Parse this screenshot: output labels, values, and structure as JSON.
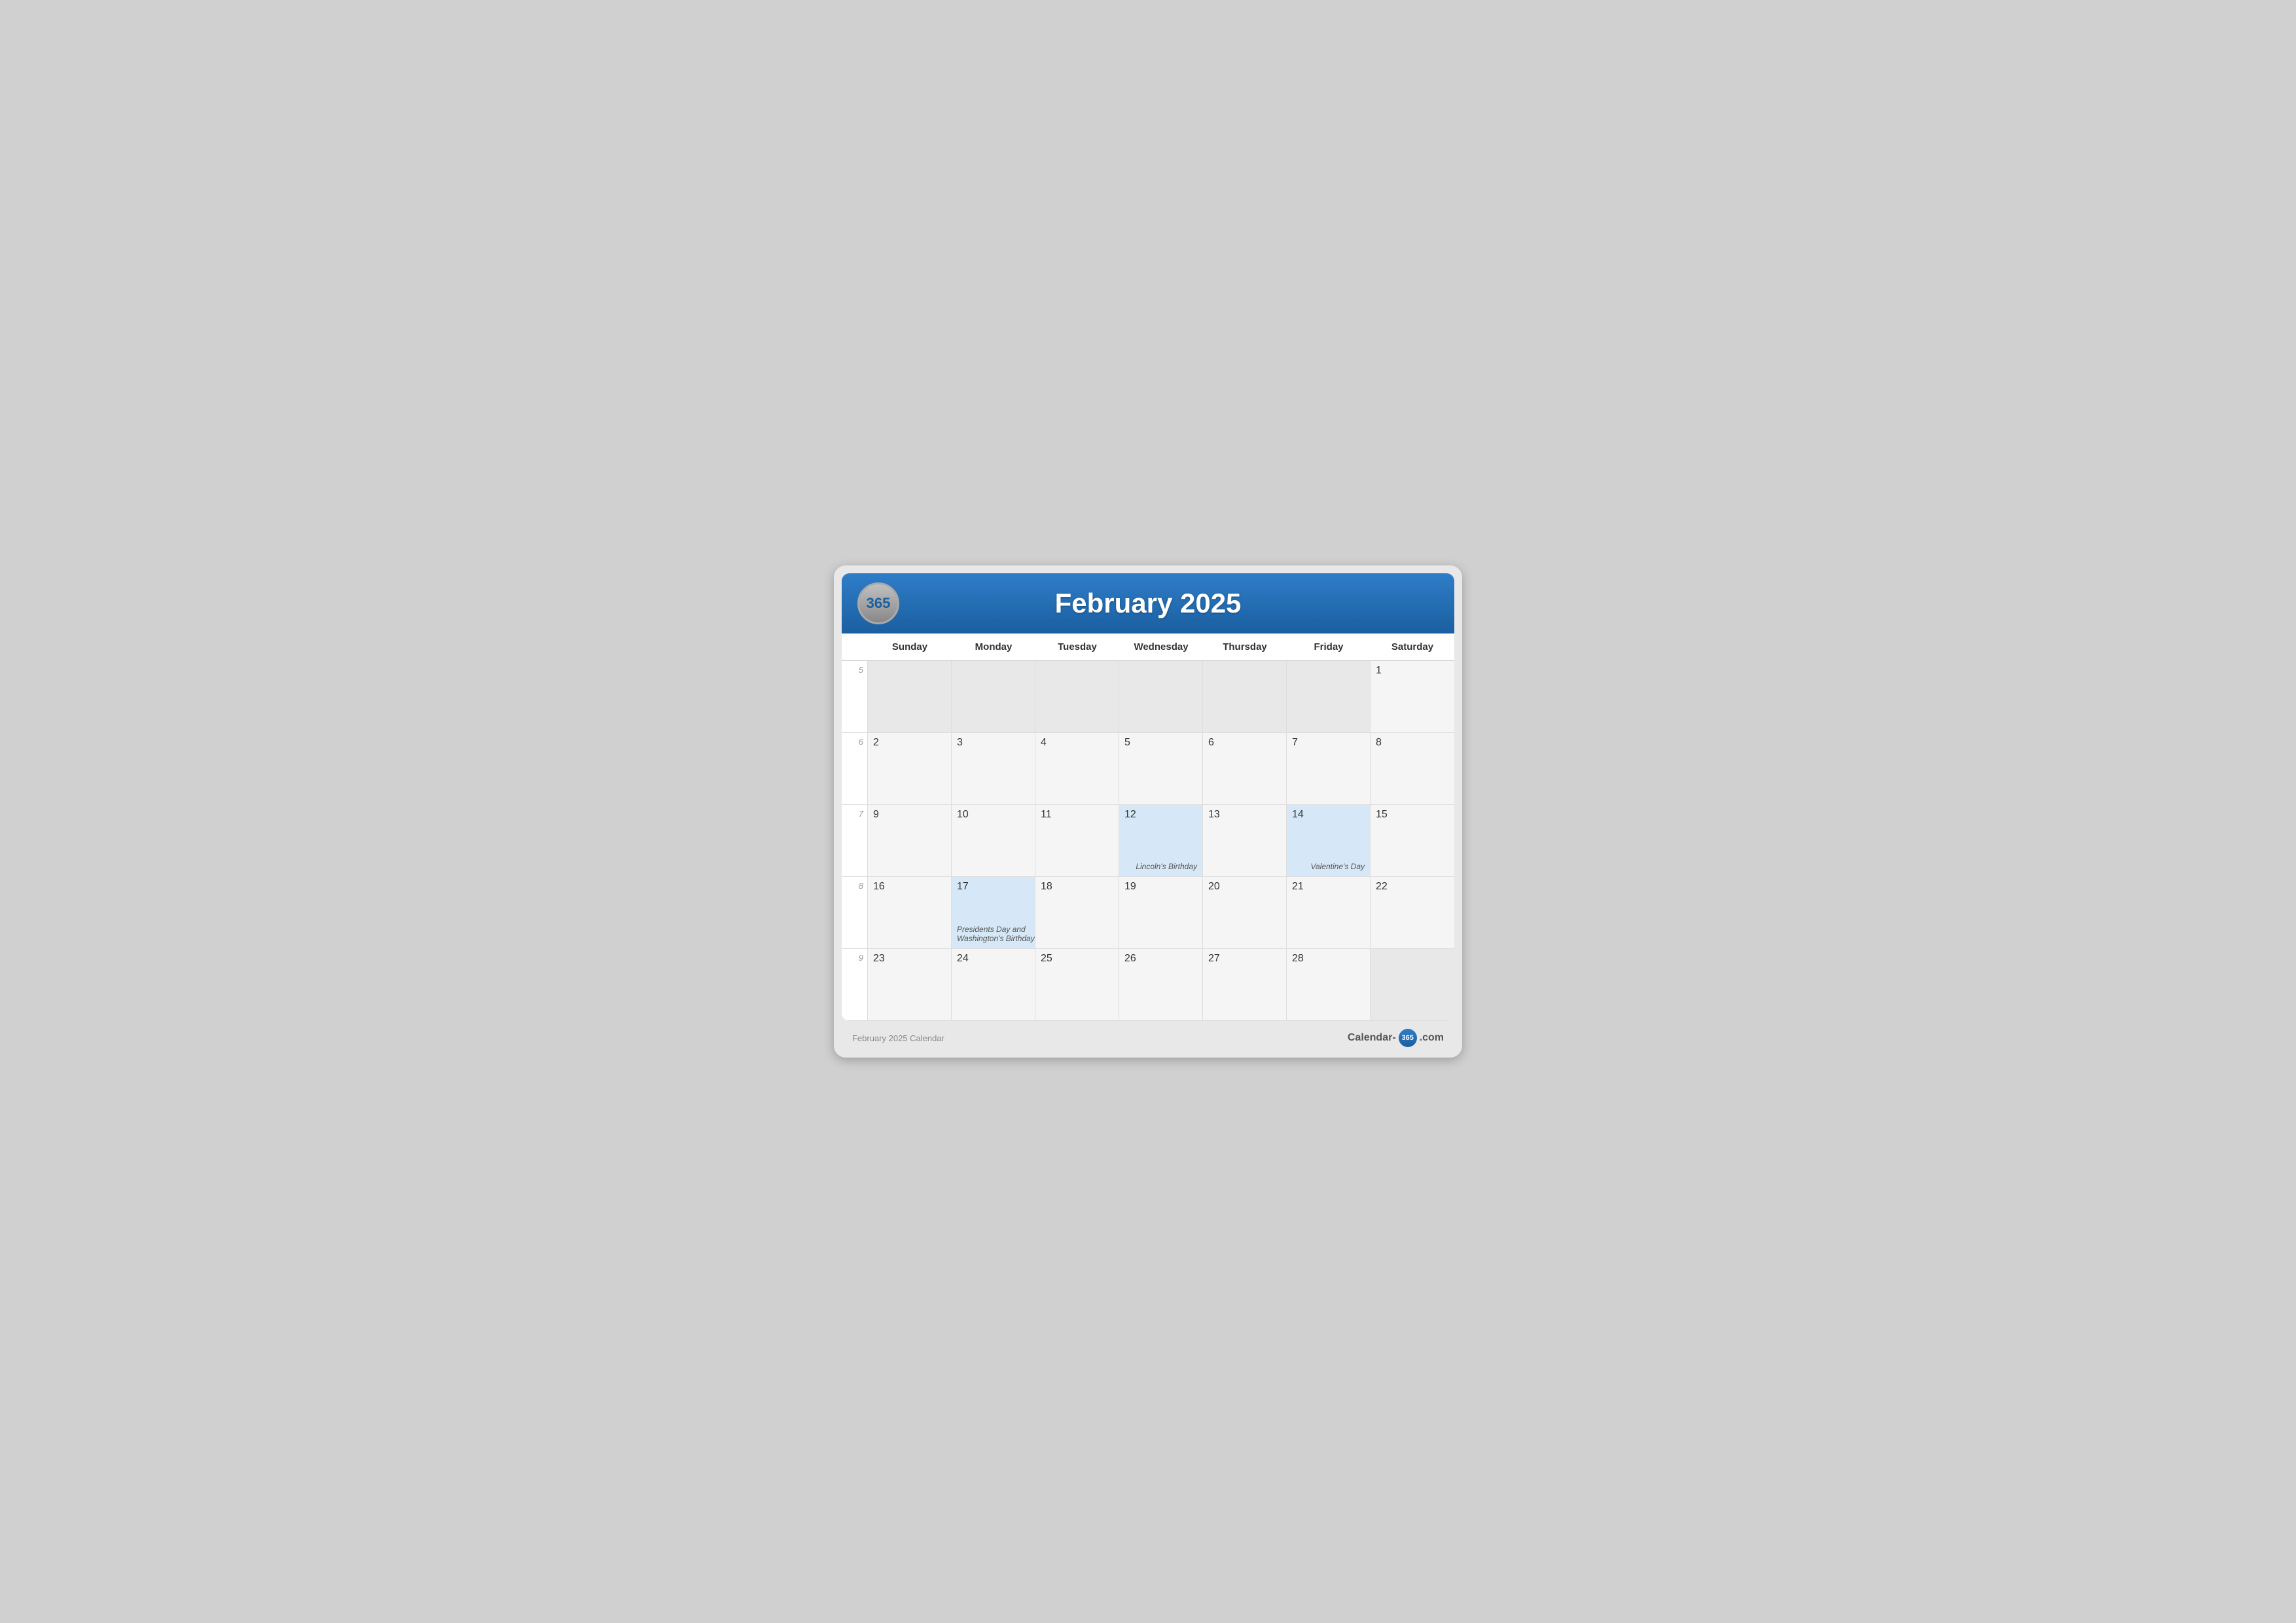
{
  "header": {
    "logo": "365",
    "title": "February 2025"
  },
  "day_headers": [
    "Sunday",
    "Monday",
    "Tuesday",
    "Wednesday",
    "Thursday",
    "Friday",
    "Saturday"
  ],
  "weeks": [
    {
      "week_number": "5",
      "days": [
        {
          "date": "",
          "type": "out-of-month",
          "event": ""
        },
        {
          "date": "",
          "type": "out-of-month",
          "event": ""
        },
        {
          "date": "",
          "type": "out-of-month",
          "event": ""
        },
        {
          "date": "",
          "type": "out-of-month",
          "event": ""
        },
        {
          "date": "",
          "type": "out-of-month",
          "event": ""
        },
        {
          "date": "",
          "type": "out-of-month",
          "event": ""
        },
        {
          "date": "1",
          "type": "current-month",
          "event": ""
        }
      ]
    },
    {
      "week_number": "6",
      "days": [
        {
          "date": "2",
          "type": "current-month",
          "event": ""
        },
        {
          "date": "3",
          "type": "current-month",
          "event": ""
        },
        {
          "date": "4",
          "type": "current-month",
          "event": ""
        },
        {
          "date": "5",
          "type": "current-month",
          "event": ""
        },
        {
          "date": "6",
          "type": "current-month",
          "event": ""
        },
        {
          "date": "7",
          "type": "current-month",
          "event": ""
        },
        {
          "date": "8",
          "type": "current-month",
          "event": ""
        }
      ]
    },
    {
      "week_number": "7",
      "days": [
        {
          "date": "9",
          "type": "current-month",
          "event": ""
        },
        {
          "date": "10",
          "type": "current-month",
          "event": ""
        },
        {
          "date": "11",
          "type": "current-month",
          "event": ""
        },
        {
          "date": "12",
          "type": "highlighted",
          "event": "Lincoln's Birthday",
          "event_position": "right"
        },
        {
          "date": "13",
          "type": "current-month",
          "event": ""
        },
        {
          "date": "14",
          "type": "highlighted",
          "event": "Valentine's Day",
          "event_position": "right"
        },
        {
          "date": "15",
          "type": "current-month",
          "event": ""
        }
      ]
    },
    {
      "week_number": "8",
      "days": [
        {
          "date": "16",
          "type": "current-month",
          "event": ""
        },
        {
          "date": "17",
          "type": "highlighted",
          "event": "Presidents Day and Washington's Birthday",
          "event_position": "bottom-left"
        },
        {
          "date": "18",
          "type": "current-month",
          "event": ""
        },
        {
          "date": "19",
          "type": "current-month",
          "event": ""
        },
        {
          "date": "20",
          "type": "current-month",
          "event": ""
        },
        {
          "date": "21",
          "type": "current-month",
          "event": ""
        },
        {
          "date": "22",
          "type": "current-month",
          "event": ""
        }
      ]
    },
    {
      "week_number": "9",
      "days": [
        {
          "date": "23",
          "type": "current-month out-month-shade",
          "event": ""
        },
        {
          "date": "24",
          "type": "current-month",
          "event": ""
        },
        {
          "date": "25",
          "type": "current-month",
          "event": ""
        },
        {
          "date": "26",
          "type": "current-month",
          "event": ""
        },
        {
          "date": "27",
          "type": "current-month",
          "event": ""
        },
        {
          "date": "28",
          "type": "current-month",
          "event": ""
        },
        {
          "date": "",
          "type": "out-of-month",
          "event": ""
        }
      ]
    }
  ],
  "footer": {
    "left_text": "February 2025 Calendar",
    "brand_prefix": "Calendar-",
    "brand_badge": "365",
    "brand_suffix": ".com"
  }
}
